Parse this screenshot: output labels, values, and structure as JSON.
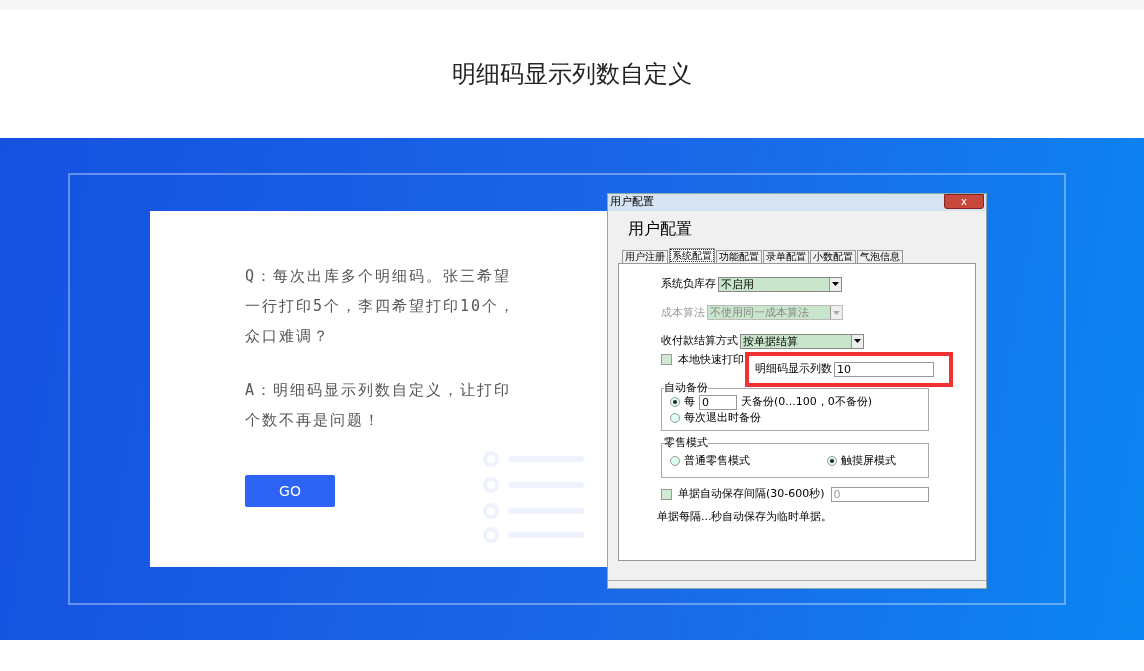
{
  "title": "明细码显示列数自定义",
  "qa": {
    "question": "Q：每次出库多个明细码。张三希望一行打印5个，李四希望打印10个，众口难调？",
    "answer": "A：明细码显示列数自定义，让打印个数不再是问题！",
    "button": "GO"
  },
  "dialog": {
    "title": "用户配置",
    "close": "x",
    "heading": "用户配置",
    "tabs": [
      {
        "label": "用户注册",
        "selected": false
      },
      {
        "label": "系统配置",
        "selected": true
      },
      {
        "label": "功能配置",
        "selected": false
      },
      {
        "label": "录单配置",
        "selected": false
      },
      {
        "label": "小数配置",
        "selected": false
      },
      {
        "label": "气泡信息",
        "selected": false
      }
    ],
    "selects": [
      {
        "label": "系统负库存",
        "value": "不启用",
        "disabled": false
      },
      {
        "label": "成本算法",
        "value": "不使用同一成本算法",
        "disabled": true
      },
      {
        "label": "收付款结算方式",
        "value": "按单据结算",
        "disabled": false
      }
    ],
    "quick_print": {
      "label": "本地快速打印",
      "checked": false
    },
    "columns_field": {
      "label": "明细码显示列数",
      "value": "10",
      "highlighted": true
    },
    "backup": {
      "legend": "自动备份",
      "options": [
        {
          "label": "每",
          "value": "0",
          "suffix": "天备份(0...100，0不备份)",
          "selected": true
        },
        {
          "label": "每次退出时备份",
          "selected": false
        }
      ]
    },
    "retail": {
      "legend": "零售模式",
      "options": [
        {
          "label": "普通零售模式",
          "selected": false
        },
        {
          "label": "触摸屏模式",
          "selected": true
        }
      ]
    },
    "autosave": {
      "label": "单据自动保存间隔(30-600秒)",
      "checked": false,
      "value": "0",
      "disabled": true
    },
    "note": "单据每隔...秒自动保存为临时单据。"
  }
}
